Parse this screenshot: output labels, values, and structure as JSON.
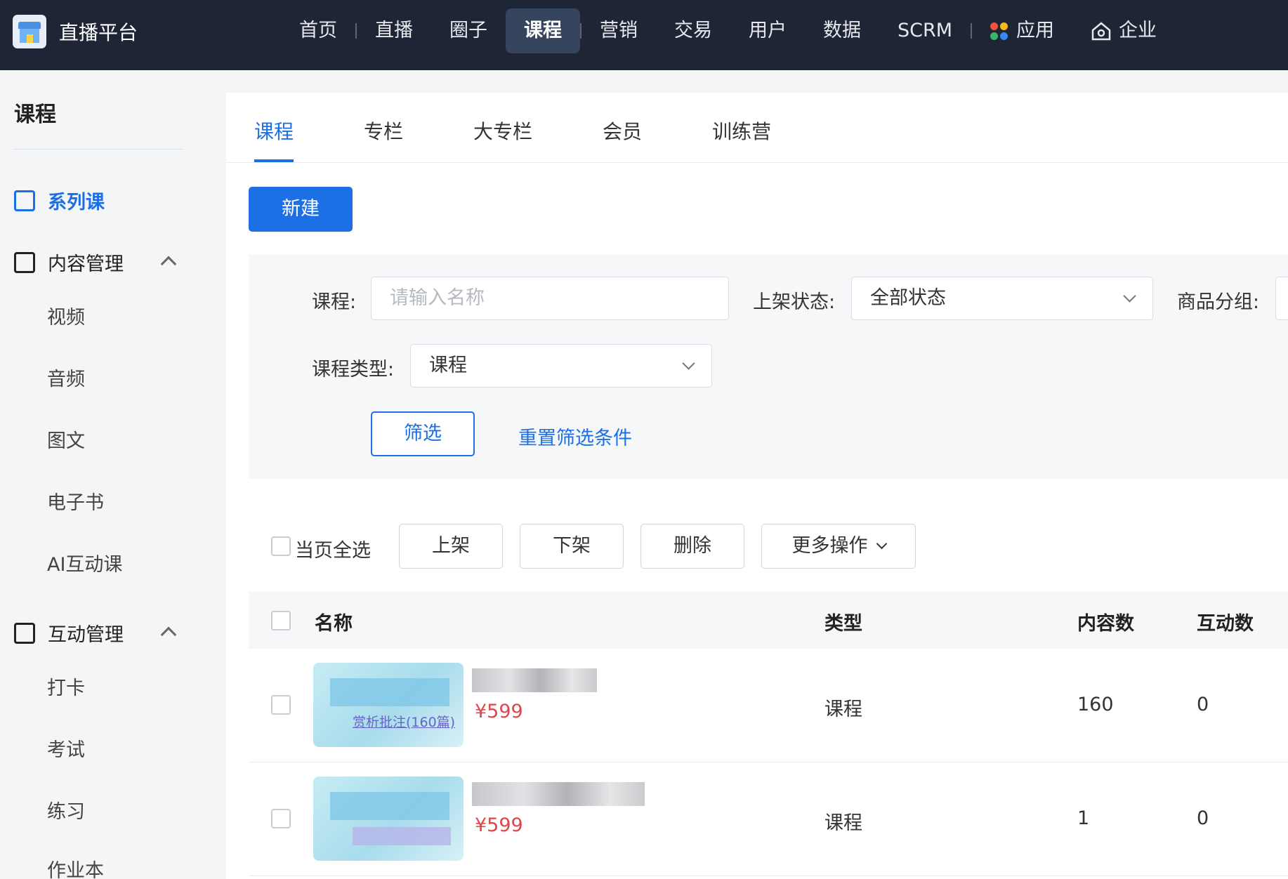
{
  "brand": {
    "title": "直播平台"
  },
  "nav": {
    "items": [
      "首页",
      "直播",
      "圈子",
      "课程",
      "营销",
      "交易",
      "用户",
      "数据",
      "SCRM",
      "应用",
      "企业"
    ],
    "active": "课程"
  },
  "sidebar": {
    "title": "课程",
    "series_course": "系列课",
    "content_group": "内容管理",
    "content_items": [
      "视频",
      "音频",
      "图文",
      "电子书",
      "AI互动课"
    ],
    "interact_group": "互动管理",
    "interact_items": [
      "打卡",
      "考试",
      "练习",
      "作业本"
    ]
  },
  "tabs": [
    "课程",
    "专栏",
    "大专栏",
    "会员",
    "训练营"
  ],
  "toolbar": {
    "new_label": "新建"
  },
  "filter": {
    "course_label": "课程:",
    "course_placeholder": "请输入名称",
    "status_label": "上架状态:",
    "status_value": "全部状态",
    "group_label": "商品分组:",
    "type_label": "课程类型:",
    "type_value": "课程",
    "filter_button": "筛选",
    "reset_link": "重置筛选条件"
  },
  "bulk": {
    "select_all": "当页全选",
    "on_shelf": "上架",
    "off_shelf": "下架",
    "delete": "删除",
    "more": "更多操作"
  },
  "table": {
    "headers": {
      "name": "名称",
      "type": "类型",
      "content_count": "内容数",
      "interact_count": "互动数"
    },
    "rows": [
      {
        "thumb_text": "赏析批注(160篇)",
        "price": "¥599",
        "type": "课程",
        "content_count": "160",
        "interact_count": "0"
      },
      {
        "price": "¥599",
        "type": "课程",
        "content_count": "1",
        "interact_count": "0"
      }
    ]
  },
  "colors": {
    "primary": "#1d6fe5",
    "topbar": "#1e2636",
    "price": "#e0454b"
  }
}
